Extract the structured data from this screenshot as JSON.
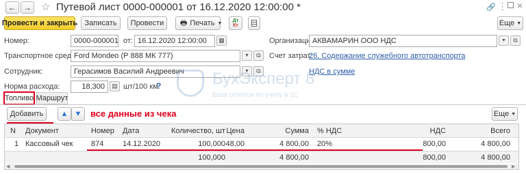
{
  "titlebar": {
    "title": "Путевой лист 0000-000001 от 16.12.2020 12:00:00 *",
    "back_icon": "←",
    "forward_icon": "→",
    "star_icon": "☆",
    "home_icon": "⌂"
  },
  "toolbar": {
    "post_close": "Провести и закрыть",
    "write": "Записать",
    "post": "Провести",
    "print": "Печать",
    "more": "Еще"
  },
  "form": {
    "number_label": "Номер:",
    "number_value": "0000-000001",
    "date_label": "от:",
    "date_value": "16.12.2020 12:00:00",
    "org_label": "Организация:",
    "org_value": "АКВАМАРИН ООО НДС",
    "vehicle_label": "Транспортное средство:",
    "vehicle_value": "Ford Mondeo (Р 888 МК 777)",
    "cost_label": "Счет затрат:",
    "cost_value": "26, Содержание служебного автотранспорта",
    "employee_label": "Сотрудник:",
    "employee_value": "Герасимов Василий Андреевич",
    "vat_link": "НДС в сумме",
    "rate_label": "Норма расхода:",
    "rate_value": "18,300",
    "rate_unit": "шт/100 км",
    "help": "?"
  },
  "watermark": {
    "title": "БухЭксперт 8",
    "subtitle": "База ответов по учету в 1С"
  },
  "tabs": {
    "fuel": "Топливо",
    "route": "Маршрут"
  },
  "table_toolbar": {
    "add": "Добавить",
    "more": "Еще",
    "annotation": "все данные из чека"
  },
  "table": {
    "headers": [
      "N",
      "Документ",
      "Номер",
      "Дата",
      "Количество, шт",
      "Цена",
      "Сумма",
      "% НДС",
      "НДС",
      "Всего"
    ],
    "rows": [
      [
        "1",
        "Кассовый чек",
        "874",
        "14.12.2020",
        "100,000",
        "48,00",
        "4 800,00",
        "20%",
        "800,00",
        "4 800,00"
      ]
    ],
    "totals": [
      "",
      "",
      "",
      "",
      "100,000",
      "",
      "4 800,00",
      "",
      "800,00",
      "4 800,00"
    ]
  },
  "colors": {
    "accent": "#f2cd2a",
    "annotation": "#e0001b",
    "tab_highlight": "#e0001b",
    "link": "#2d5ea8"
  }
}
